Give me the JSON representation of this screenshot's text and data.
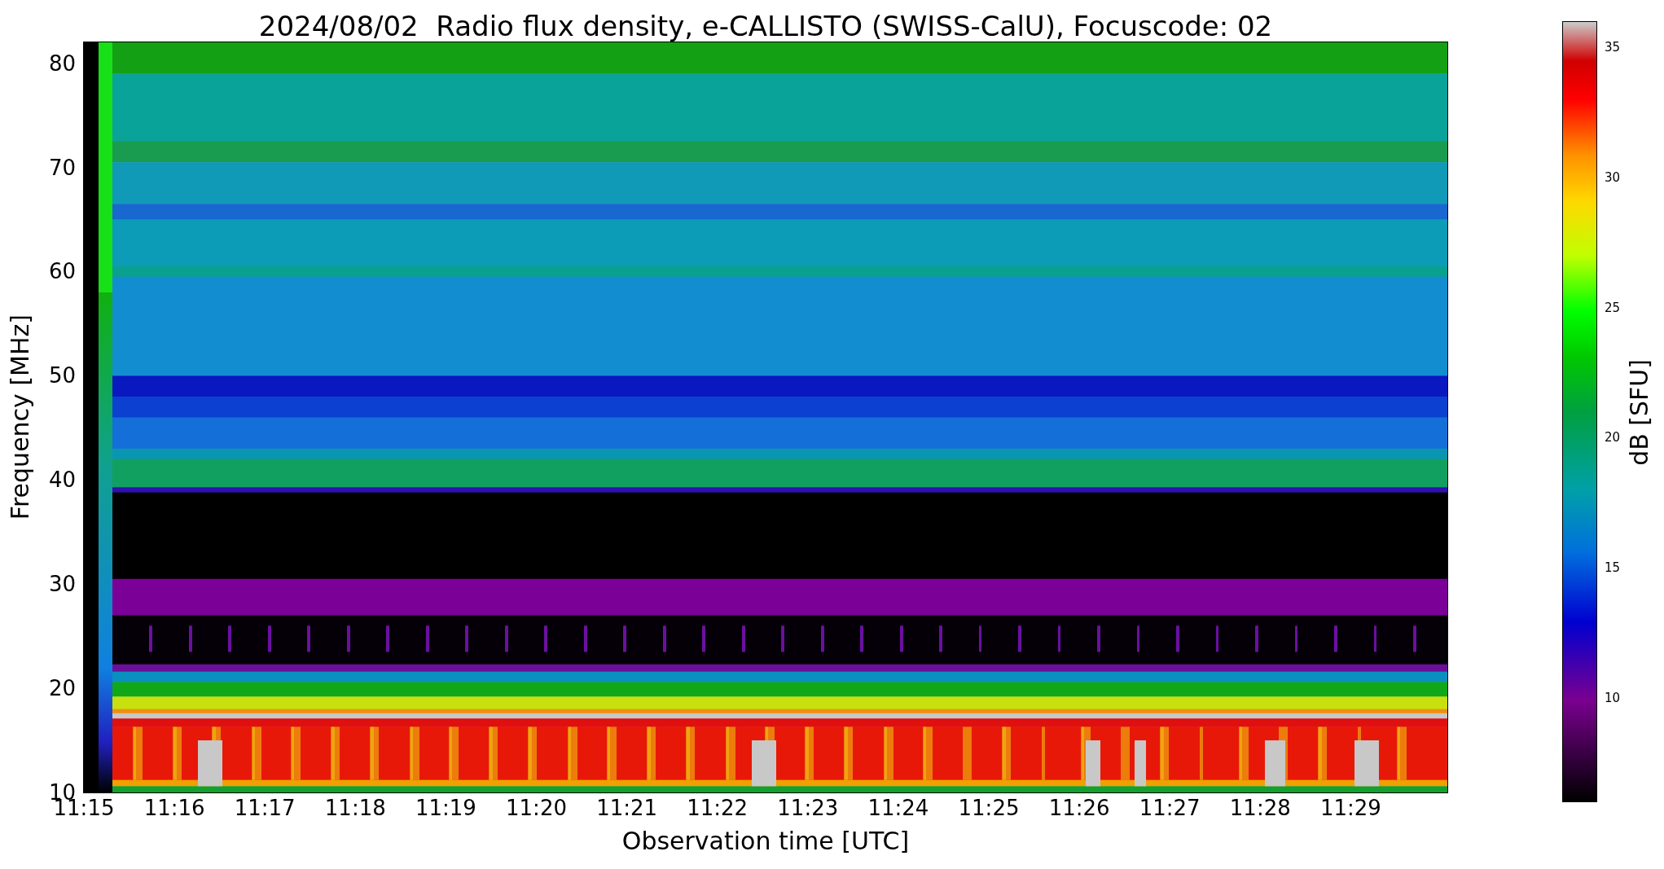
{
  "title": "2024/08/02  Radio flux density, e-CALLISTO (SWISS-CalU), Focuscode: 02",
  "x_axis": {
    "label": "Observation time [UTC]",
    "ticks": [
      "11:15",
      "11:16",
      "11:17",
      "11:18",
      "11:19",
      "11:20",
      "11:21",
      "11:22",
      "11:23",
      "11:24",
      "11:25",
      "11:26",
      "11:27",
      "11:28",
      "11:29"
    ]
  },
  "y_axis": {
    "label": "Frequency [MHz]",
    "ticks": [
      "80",
      "70",
      "60",
      "50",
      "40",
      "30",
      "20",
      "10"
    ]
  },
  "colorbar": {
    "label": "dB [SFU]",
    "ticks": [
      "35",
      "30",
      "25",
      "20",
      "15",
      "10"
    ]
  }
}
